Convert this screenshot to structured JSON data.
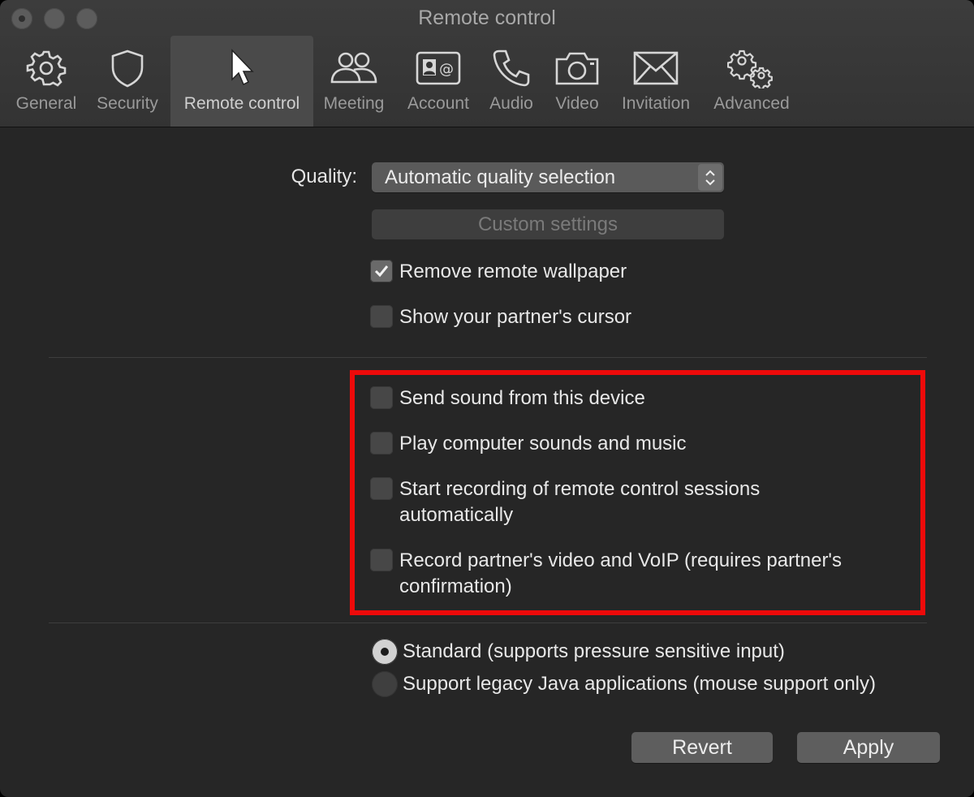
{
  "window": {
    "title": "Remote control"
  },
  "tabs": [
    {
      "label": "General",
      "icon": "gear-icon"
    },
    {
      "label": "Security",
      "icon": "shield-icon"
    },
    {
      "label": "Remote control",
      "icon": "cursor-icon",
      "selected": true
    },
    {
      "label": "Meeting",
      "icon": "people-icon"
    },
    {
      "label": "Account",
      "icon": "contact-card-icon"
    },
    {
      "label": "Audio",
      "icon": "phone-icon"
    },
    {
      "label": "Video",
      "icon": "camera-icon"
    },
    {
      "label": "Invitation",
      "icon": "envelope-icon"
    },
    {
      "label": "Advanced",
      "icon": "gears-icon"
    }
  ],
  "quality": {
    "label": "Quality:",
    "selected": "Automatic quality selection"
  },
  "custom_settings_label": "Custom settings",
  "display_options": [
    {
      "label": "Remove remote wallpaper",
      "checked": true
    },
    {
      "label": "Show your partner's cursor",
      "checked": false
    }
  ],
  "audio_options": [
    {
      "label": "Send sound from this device",
      "checked": false
    },
    {
      "label": "Play computer sounds and music",
      "checked": false
    },
    {
      "label_line1": "Start recording of remote control sessions",
      "label_line2": "automatically",
      "checked": false
    },
    {
      "label_line1": "Record partner's video and VoIP (requires partner's",
      "label_line2": "confirmation)",
      "checked": false
    }
  ],
  "input_mode": [
    {
      "label": "Standard (supports pressure sensitive input)",
      "selected": true
    },
    {
      "label": "Support legacy Java applications (mouse support only)",
      "selected": false
    }
  ],
  "buttons": {
    "revert": "Revert",
    "apply": "Apply"
  },
  "colors": {
    "highlight": "#ee0a0a",
    "background": "#262626"
  }
}
